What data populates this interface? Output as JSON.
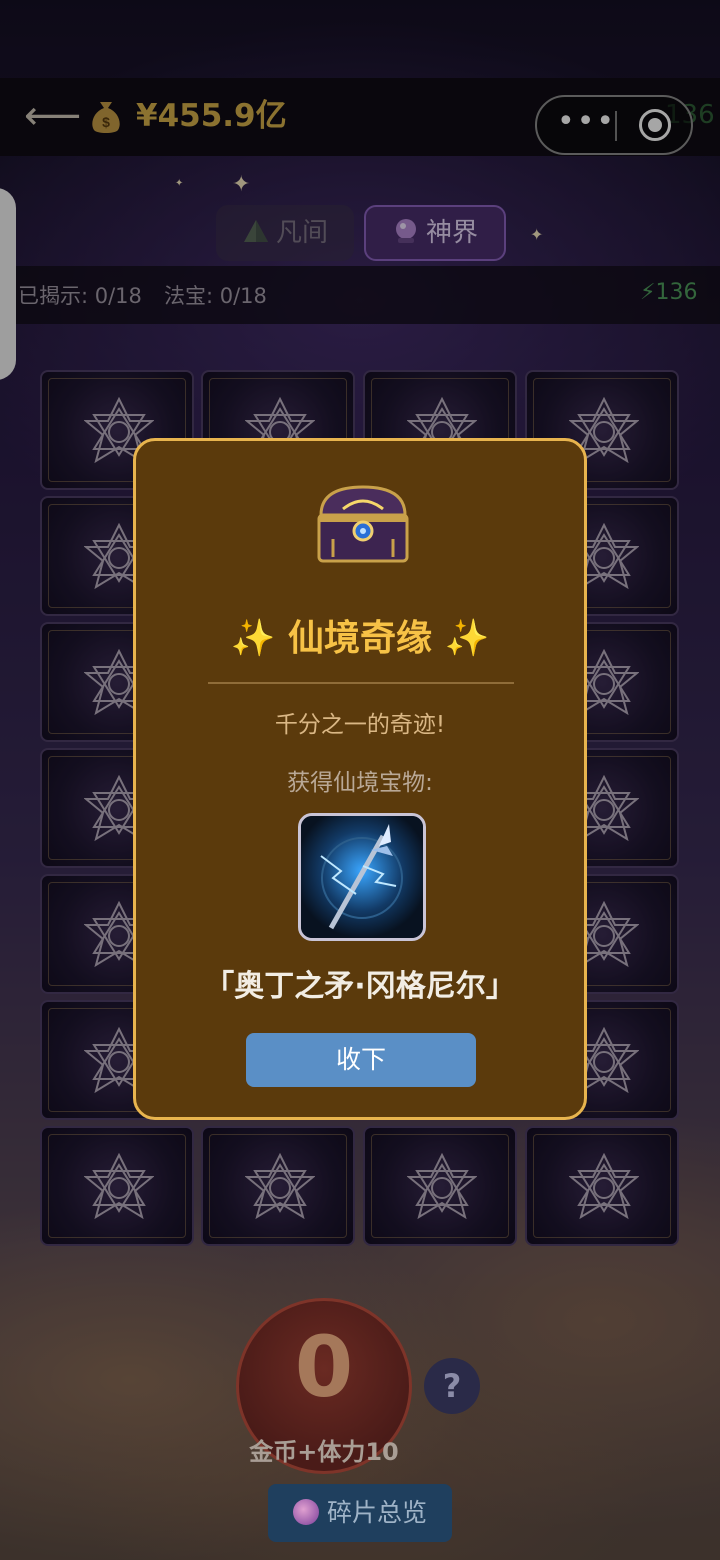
{
  "header": {
    "back_icon": "arrow-left-icon",
    "money_icon": "money-bag-icon",
    "money": "¥455.9亿",
    "ghost_energy": "136"
  },
  "tabs": [
    {
      "label": "凡间",
      "icon": "pyramid-icon",
      "active": false
    },
    {
      "label": "神界",
      "icon": "crystal-ball-icon",
      "active": true
    }
  ],
  "stats": {
    "revealed": "已揭示: 0/18",
    "treasures": "法宝: 0/18",
    "energy": "136",
    "energy_icon": "lightning-icon"
  },
  "modal": {
    "title": "✨ 仙境奇缘 ✨",
    "subtitle": "千分之一的奇迹!",
    "prompt": "获得仙境宝物:",
    "item_name": "「奥丁之矛·冈格尼尔」",
    "accept": "收下"
  },
  "bottom": {
    "count": "0",
    "count_label": "金币+体力10",
    "help": "?",
    "overview": "碎片总览"
  },
  "colors": {
    "accent_gold": "#f7c246",
    "modal_bg": "#5b3a0c",
    "modal_border": "#e8b44e",
    "button_blue": "#5a8fc6",
    "tab_active": "#4b2f6e"
  }
}
